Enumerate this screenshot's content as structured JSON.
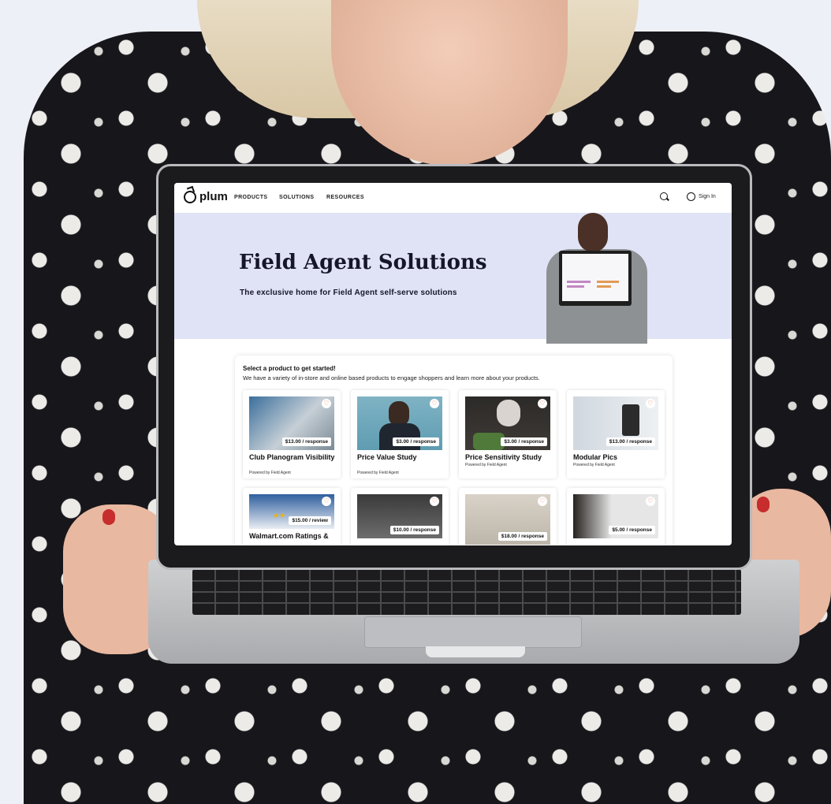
{
  "nav": {
    "brand": "plum",
    "items": [
      "PRODUCTS",
      "SOLUTIONS",
      "RESOURCES"
    ],
    "sign_in": "Sign In"
  },
  "hero": {
    "title": "Field Agent Solutions",
    "subtitle": "The exclusive home for Field Agent self-serve solutions"
  },
  "panel": {
    "title": "Select a product to get started!",
    "subtitle": "We have a variety of in-store and online based products to engage shoppers and learn more about your products."
  },
  "cards": [
    {
      "title": "Club Planogram Visibility",
      "price": "$13.00 / response",
      "powered": "Powered by Field Agent"
    },
    {
      "title": "Price Value Study",
      "price": "$3.00 / response",
      "powered": "Powered by Field Agent"
    },
    {
      "title": "Price Sensitivity Study",
      "price": "$3.00 / response",
      "powered": "Powered by Field Agent"
    },
    {
      "title": "Modular Pics",
      "price": "$13.00 / response",
      "powered": "Powered by Field Agent"
    },
    {
      "title": "Walmart.com Ratings &",
      "price": "$15.00 / review",
      "powered": ""
    },
    {
      "title": "",
      "price": "$10.00 / response",
      "powered": ""
    },
    {
      "title": "",
      "price": "$18.00 / response",
      "powered": ""
    },
    {
      "title": "",
      "price": "$5.00 / response",
      "powered": ""
    }
  ],
  "colors": {
    "hero_bg": "#dfe3f5",
    "heart": "#e0826a",
    "text": "#16162a"
  }
}
